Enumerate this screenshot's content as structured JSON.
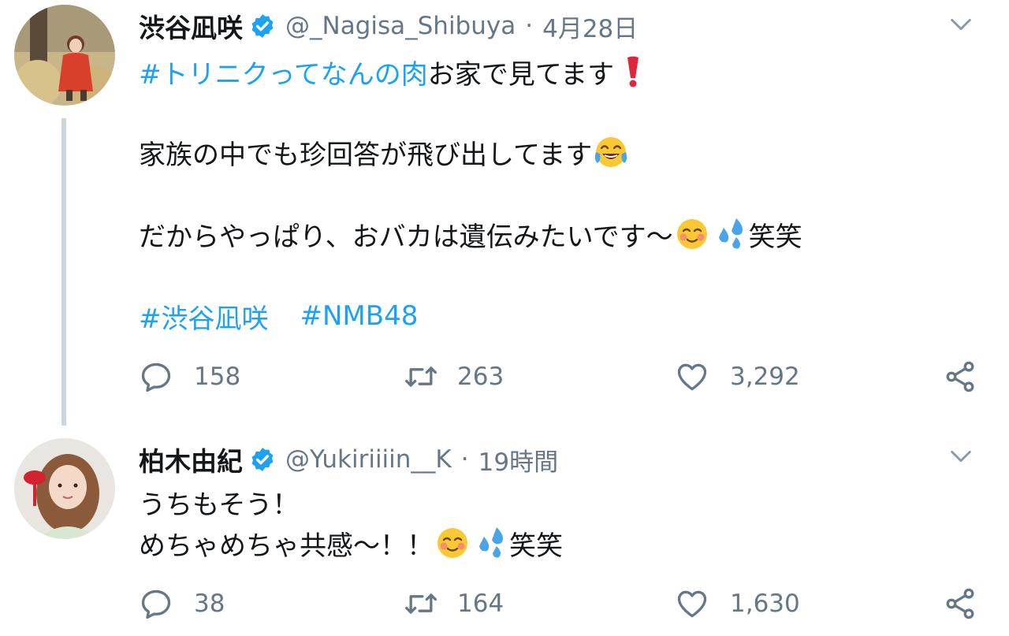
{
  "tweets": [
    {
      "name": "渋谷凪咲",
      "handle": "@_Nagisa_Shibuya",
      "separator": "·",
      "time": "4月28日",
      "verified": true,
      "line1_hashtag": "#トリニクってなんの肉",
      "line1_text": " お家で見てます",
      "line2_text": "家族の中でも珍回答が飛び出してます",
      "line3_text": "だからやっぱり、おバカは遺伝みたいです〜",
      "line3_suffix": "笑笑",
      "hashtags": [
        "#渋谷凪咲",
        "#NMB48"
      ],
      "replies": "158",
      "retweets": "263",
      "likes": "3,292"
    },
    {
      "name": "柏木由紀",
      "handle": "@Yukiriiiin__K",
      "separator": "·",
      "time": "19時間",
      "verified": true,
      "line1_text": "うちもそう！",
      "line2_text": "めちゃめちゃ共感〜！！",
      "line2_suffix": "笑笑",
      "replies": "38",
      "retweets": "164",
      "likes": "1,630"
    }
  ],
  "colors": {
    "link": "#1da1f2",
    "muted": "#657786",
    "verified": "#1da1f2",
    "thread_line": "#ccd6dd"
  },
  "icons": {
    "verified": "verified-badge-icon",
    "more": "chevron-down-icon",
    "reply": "reply-icon",
    "retweet": "retweet-icon",
    "like": "heart-icon",
    "share": "share-icon",
    "emoji_exclamation": "red-exclamation-emoji",
    "emoji_laugh": "tears-of-joy-emoji",
    "emoji_smile": "smiling-blush-emoji",
    "emoji_sweat": "sweat-droplets-emoji"
  }
}
